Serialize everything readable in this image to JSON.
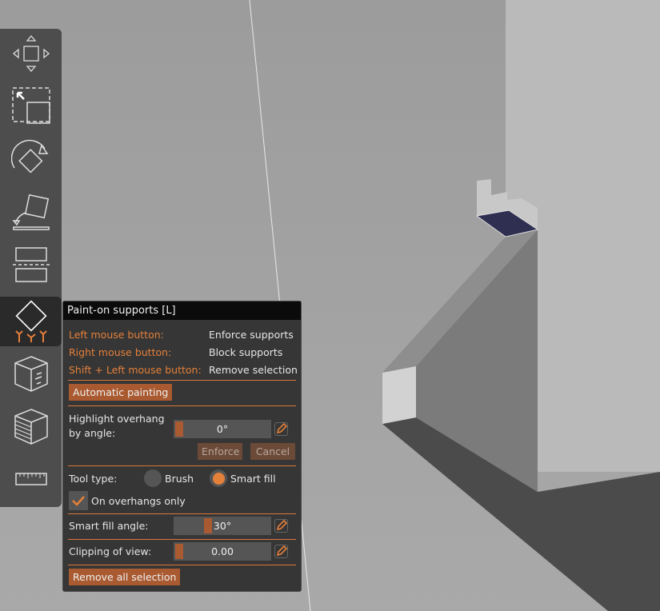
{
  "toolbar": {
    "items": [
      "move",
      "scale",
      "rotate",
      "place-on-face",
      "cut",
      "paint-on-supports",
      "seam-painting",
      "variable-layer-height",
      "measure"
    ],
    "selected": "paint-on-supports"
  },
  "panel": {
    "title": "Paint-on supports [L]",
    "shortcuts": [
      {
        "key": "Left mouse button:",
        "action": "Enforce supports"
      },
      {
        "key": "Right mouse button:",
        "action": "Block supports"
      },
      {
        "key": "Shift + Left mouse button:",
        "action": "Remove selection"
      }
    ],
    "automatic_painting": "Automatic painting",
    "highlight_label_1": "Highlight overhang",
    "highlight_label_2": "by angle:",
    "highlight_value": "0°",
    "highlight_fraction": 0,
    "enforce": "Enforce",
    "cancel": "Cancel",
    "tool_type_label": "Tool type:",
    "brush": "Brush",
    "smart_fill": "Smart fill",
    "selected_tool": "Smart fill",
    "overhangs_only": "On overhangs only",
    "overhangs_only_checked": true,
    "smart_fill_angle_label": "Smart fill angle:",
    "smart_fill_angle_value": "30°",
    "smart_fill_fraction": 0.33,
    "clipping_label": "Clipping of view:",
    "clipping_value": "0.00",
    "clipping_fraction": 0,
    "remove_all": "Remove all selection"
  },
  "colors": {
    "accent": "#e4803a",
    "button": "#a95a30",
    "panel": "#363636"
  }
}
